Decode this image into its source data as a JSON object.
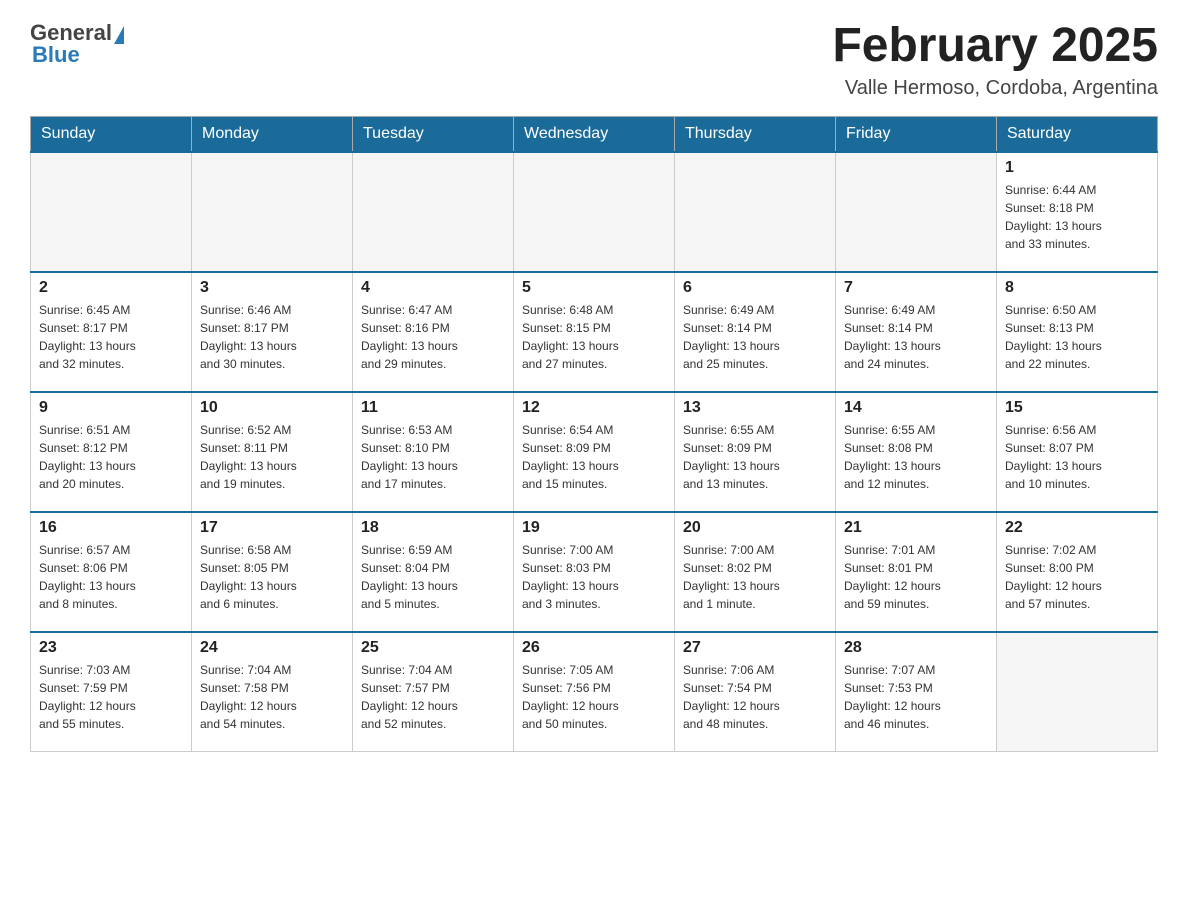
{
  "header": {
    "logo_general": "General",
    "logo_blue": "Blue",
    "month_title": "February 2025",
    "location": "Valle Hermoso, Cordoba, Argentina"
  },
  "days_of_week": [
    "Sunday",
    "Monday",
    "Tuesday",
    "Wednesday",
    "Thursday",
    "Friday",
    "Saturday"
  ],
  "weeks": [
    [
      {
        "day": "",
        "info": ""
      },
      {
        "day": "",
        "info": ""
      },
      {
        "day": "",
        "info": ""
      },
      {
        "day": "",
        "info": ""
      },
      {
        "day": "",
        "info": ""
      },
      {
        "day": "",
        "info": ""
      },
      {
        "day": "1",
        "info": "Sunrise: 6:44 AM\nSunset: 8:18 PM\nDaylight: 13 hours\nand 33 minutes."
      }
    ],
    [
      {
        "day": "2",
        "info": "Sunrise: 6:45 AM\nSunset: 8:17 PM\nDaylight: 13 hours\nand 32 minutes."
      },
      {
        "day": "3",
        "info": "Sunrise: 6:46 AM\nSunset: 8:17 PM\nDaylight: 13 hours\nand 30 minutes."
      },
      {
        "day": "4",
        "info": "Sunrise: 6:47 AM\nSunset: 8:16 PM\nDaylight: 13 hours\nand 29 minutes."
      },
      {
        "day": "5",
        "info": "Sunrise: 6:48 AM\nSunset: 8:15 PM\nDaylight: 13 hours\nand 27 minutes."
      },
      {
        "day": "6",
        "info": "Sunrise: 6:49 AM\nSunset: 8:14 PM\nDaylight: 13 hours\nand 25 minutes."
      },
      {
        "day": "7",
        "info": "Sunrise: 6:49 AM\nSunset: 8:14 PM\nDaylight: 13 hours\nand 24 minutes."
      },
      {
        "day": "8",
        "info": "Sunrise: 6:50 AM\nSunset: 8:13 PM\nDaylight: 13 hours\nand 22 minutes."
      }
    ],
    [
      {
        "day": "9",
        "info": "Sunrise: 6:51 AM\nSunset: 8:12 PM\nDaylight: 13 hours\nand 20 minutes."
      },
      {
        "day": "10",
        "info": "Sunrise: 6:52 AM\nSunset: 8:11 PM\nDaylight: 13 hours\nand 19 minutes."
      },
      {
        "day": "11",
        "info": "Sunrise: 6:53 AM\nSunset: 8:10 PM\nDaylight: 13 hours\nand 17 minutes."
      },
      {
        "day": "12",
        "info": "Sunrise: 6:54 AM\nSunset: 8:09 PM\nDaylight: 13 hours\nand 15 minutes."
      },
      {
        "day": "13",
        "info": "Sunrise: 6:55 AM\nSunset: 8:09 PM\nDaylight: 13 hours\nand 13 minutes."
      },
      {
        "day": "14",
        "info": "Sunrise: 6:55 AM\nSunset: 8:08 PM\nDaylight: 13 hours\nand 12 minutes."
      },
      {
        "day": "15",
        "info": "Sunrise: 6:56 AM\nSunset: 8:07 PM\nDaylight: 13 hours\nand 10 minutes."
      }
    ],
    [
      {
        "day": "16",
        "info": "Sunrise: 6:57 AM\nSunset: 8:06 PM\nDaylight: 13 hours\nand 8 minutes."
      },
      {
        "day": "17",
        "info": "Sunrise: 6:58 AM\nSunset: 8:05 PM\nDaylight: 13 hours\nand 6 minutes."
      },
      {
        "day": "18",
        "info": "Sunrise: 6:59 AM\nSunset: 8:04 PM\nDaylight: 13 hours\nand 5 minutes."
      },
      {
        "day": "19",
        "info": "Sunrise: 7:00 AM\nSunset: 8:03 PM\nDaylight: 13 hours\nand 3 minutes."
      },
      {
        "day": "20",
        "info": "Sunrise: 7:00 AM\nSunset: 8:02 PM\nDaylight: 13 hours\nand 1 minute."
      },
      {
        "day": "21",
        "info": "Sunrise: 7:01 AM\nSunset: 8:01 PM\nDaylight: 12 hours\nand 59 minutes."
      },
      {
        "day": "22",
        "info": "Sunrise: 7:02 AM\nSunset: 8:00 PM\nDaylight: 12 hours\nand 57 minutes."
      }
    ],
    [
      {
        "day": "23",
        "info": "Sunrise: 7:03 AM\nSunset: 7:59 PM\nDaylight: 12 hours\nand 55 minutes."
      },
      {
        "day": "24",
        "info": "Sunrise: 7:04 AM\nSunset: 7:58 PM\nDaylight: 12 hours\nand 54 minutes."
      },
      {
        "day": "25",
        "info": "Sunrise: 7:04 AM\nSunset: 7:57 PM\nDaylight: 12 hours\nand 52 minutes."
      },
      {
        "day": "26",
        "info": "Sunrise: 7:05 AM\nSunset: 7:56 PM\nDaylight: 12 hours\nand 50 minutes."
      },
      {
        "day": "27",
        "info": "Sunrise: 7:06 AM\nSunset: 7:54 PM\nDaylight: 12 hours\nand 48 minutes."
      },
      {
        "day": "28",
        "info": "Sunrise: 7:07 AM\nSunset: 7:53 PM\nDaylight: 12 hours\nand 46 minutes."
      },
      {
        "day": "",
        "info": ""
      }
    ]
  ]
}
